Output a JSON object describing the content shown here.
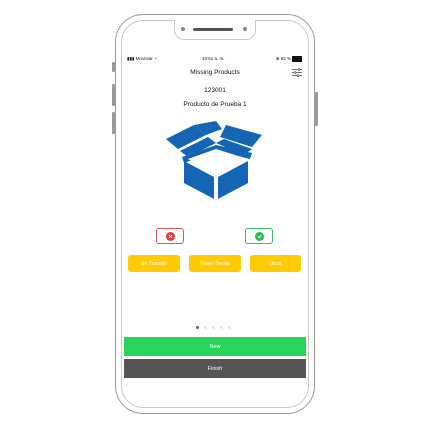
{
  "status_bar": {
    "carrier": "Movistar",
    "time": "10:51 a. m.",
    "battery": "82 %"
  },
  "header": {
    "title": "Missing Products",
    "filter_icon": "sliders-icon"
  },
  "product": {
    "code": "123001",
    "name": "Producto de Prueba 1",
    "image_icon": "open-box-icon"
  },
  "actions": {
    "reject_icon": "x-icon",
    "accept_icon": "check-icon"
  },
  "chips": [
    {
      "label": "En Transito"
    },
    {
      "label": "Trans-Tienda"
    },
    {
      "label": "Otros"
    }
  ],
  "pager": {
    "total": 5,
    "active": 1
  },
  "buttons": {
    "new_label": "New",
    "finish_label": "Finish"
  },
  "colors": {
    "chip_yellow": "#ffcb05",
    "new_green": "#2ad35a",
    "finish_gray": "#555555",
    "box_blue": "#1565b5",
    "reject_red": "#e53935",
    "accept_green": "#2fb84f",
    "pager_active": "#7a4aa0"
  }
}
